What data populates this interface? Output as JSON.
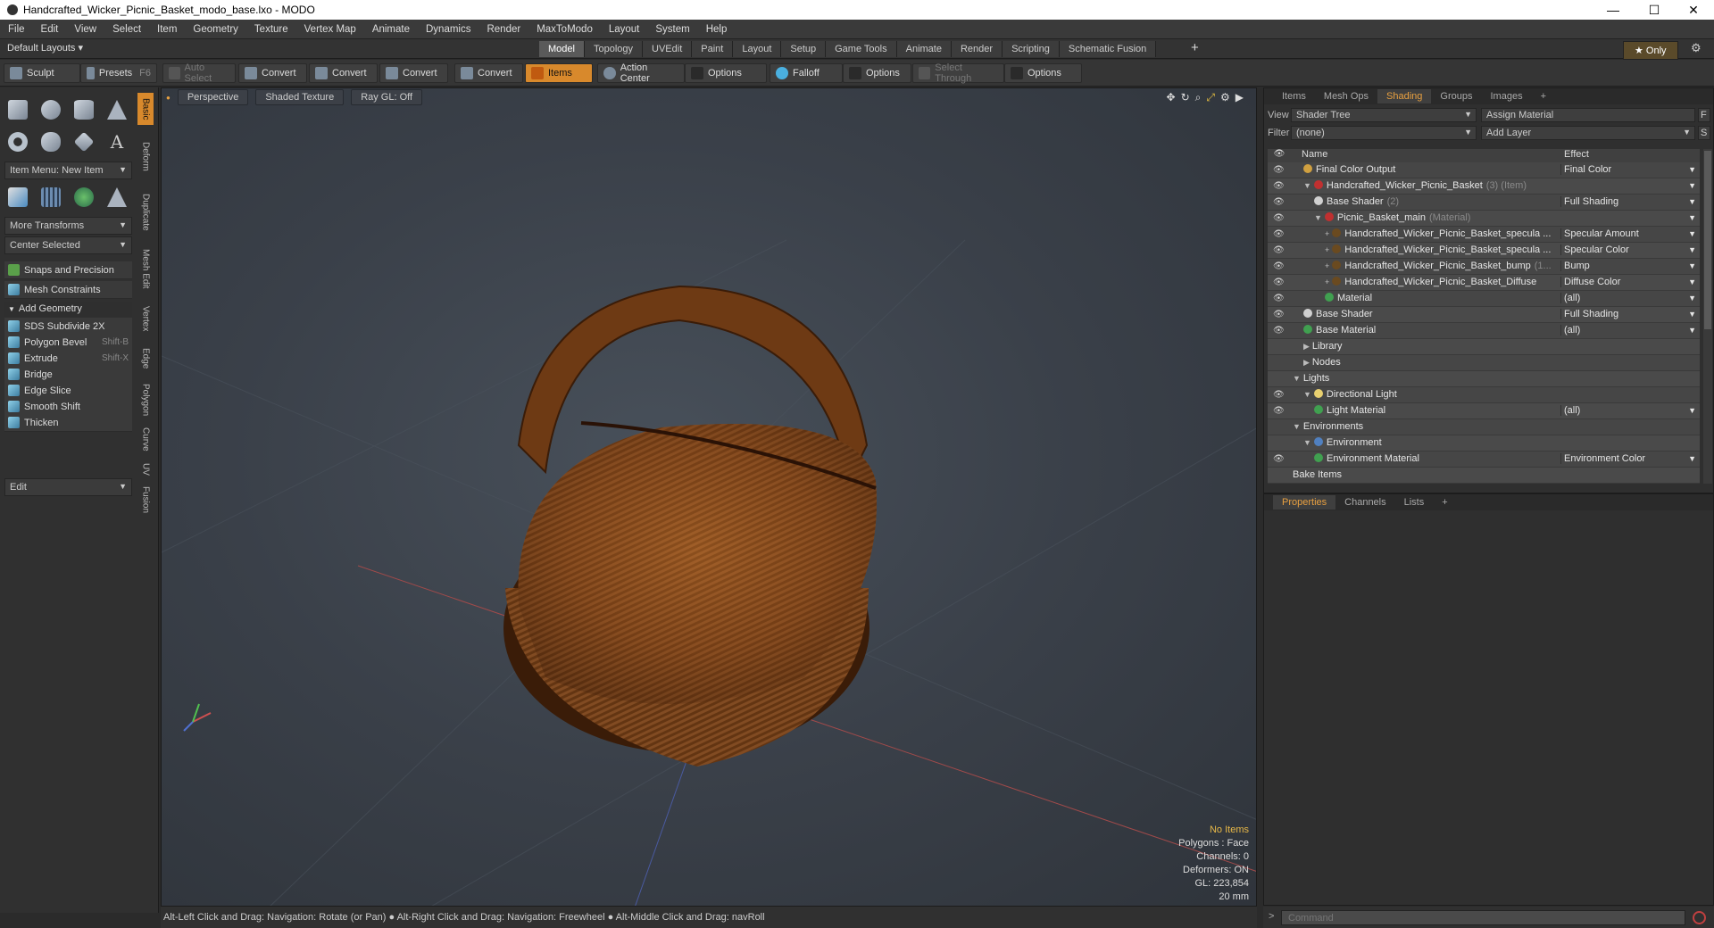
{
  "window": {
    "title": "Handcrafted_Wicker_Picnic_Basket_modo_base.lxo - MODO"
  },
  "menu": [
    "File",
    "Edit",
    "View",
    "Select",
    "Item",
    "Geometry",
    "Texture",
    "Vertex Map",
    "Animate",
    "Dynamics",
    "Render",
    "MaxToModo",
    "Layout",
    "System",
    "Help"
  ],
  "layout": {
    "default": "Default Layouts ▾",
    "tabs": [
      "Model",
      "Topology",
      "UVEdit",
      "Paint",
      "Layout",
      "Setup",
      "Game Tools",
      "Animate",
      "Render",
      "Scripting",
      "Schematic Fusion"
    ],
    "active": "Model",
    "plus": "+",
    "only": "★  Only"
  },
  "toolbar": {
    "sculpt": "Sculpt",
    "presets": "Presets",
    "presets_key": "F6",
    "auto_select": "Auto Select",
    "convert": "Convert",
    "items": "Items",
    "action_center": "Action Center",
    "options": "Options",
    "falloff": "Falloff",
    "select_through": "Select Through"
  },
  "left": {
    "item_menu": "Item Menu: New Item",
    "more_transforms": "More Transforms",
    "center_selected": "Center Selected",
    "snaps": "Snaps and Precision",
    "mesh_constraints": "Mesh Constraints",
    "add_geometry": "Add Geometry",
    "tools": [
      {
        "label": "SDS Subdivide 2X",
        "key": ""
      },
      {
        "label": "Polygon Bevel",
        "key": "Shift-B"
      },
      {
        "label": "Extrude",
        "key": "Shift-X"
      },
      {
        "label": "Bridge",
        "key": ""
      },
      {
        "label": "Edge Slice",
        "key": ""
      },
      {
        "label": "Smooth Shift",
        "key": ""
      },
      {
        "label": "Thicken",
        "key": ""
      }
    ],
    "edit": "Edit",
    "vtabs": [
      "Basic",
      "Deform",
      "Duplicate",
      "Mesh Edit",
      "Vertex",
      "Edge",
      "Polygon",
      "Curve",
      "UV",
      "Fusion"
    ]
  },
  "viewport": {
    "perspective": "Perspective",
    "shading": "Shaded Texture",
    "raygl": "Ray GL: Off",
    "stats": {
      "items": "No Items",
      "polygons": "Polygons : Face",
      "channels": "Channels: 0",
      "deformers": "Deformers: ON",
      "gl": "GL: 223,854",
      "scale": "20 mm"
    }
  },
  "status": "Alt-Left Click and Drag: Navigation: Rotate (or Pan) ● Alt-Right Click and Drag: Navigation: Freewheel ● Alt-Middle Click and Drag: navRoll",
  "command": {
    "placeholder": "Command"
  },
  "shading": {
    "tabs": [
      "Items",
      "Mesh Ops",
      "Shading",
      "Groups",
      "Images",
      "+"
    ],
    "active": "Shading",
    "view_label": "View",
    "view_value": "Shader Tree",
    "assign": "Assign Material",
    "f": "F",
    "filter_label": "Filter",
    "filter_value": "(none)",
    "add_layer": "Add Layer",
    "s": "S",
    "col_name": "Name",
    "col_effect": "Effect",
    "rows": [
      {
        "indent": 1,
        "name": "Final Color Output",
        "suffix": "",
        "effect": "Final Color",
        "ball": "#d0a040",
        "eye": true,
        "exp": "",
        "dd": true
      },
      {
        "indent": 1,
        "name": "Handcrafted_Wicker_Picnic_Basket",
        "suffix": "(3) (Item)",
        "effect": "",
        "ball": "#c03030",
        "eye": true,
        "exp": "▼",
        "dd": true
      },
      {
        "indent": 2,
        "name": "Base Shader",
        "suffix": "(2)",
        "effect": "Full Shading",
        "ball": "#d0d0d0",
        "eye": true,
        "exp": "",
        "dd": true
      },
      {
        "indent": 2,
        "name": "Picnic_Basket_main",
        "suffix": "(Material)",
        "effect": "",
        "ball": "#c03030",
        "eye": true,
        "exp": "▼",
        "dd": true
      },
      {
        "indent": 3,
        "name": "Handcrafted_Wicker_Picnic_Basket_specula ...",
        "suffix": "",
        "effect": "Specular Amount",
        "ball": "#6a4a20",
        "eye": true,
        "exp": "+",
        "dd": true
      },
      {
        "indent": 3,
        "name": "Handcrafted_Wicker_Picnic_Basket_specula ...",
        "suffix": "",
        "effect": "Specular Color",
        "ball": "#6a4a20",
        "eye": true,
        "exp": "+",
        "dd": true
      },
      {
        "indent": 3,
        "name": "Handcrafted_Wicker_Picnic_Basket_bump",
        "suffix": "(1...",
        "effect": "Bump",
        "ball": "#6a4a20",
        "eye": true,
        "exp": "+",
        "dd": true
      },
      {
        "indent": 3,
        "name": "Handcrafted_Wicker_Picnic_Basket_Diffuse",
        "suffix": "",
        "effect": "Diffuse Color",
        "ball": "#6a4a20",
        "eye": true,
        "exp": "+",
        "dd": true
      },
      {
        "indent": 3,
        "name": "Material",
        "suffix": "",
        "effect": "(all)",
        "ball": "#40a050",
        "eye": true,
        "exp": "",
        "dd": true
      },
      {
        "indent": 1,
        "name": "Base Shader",
        "suffix": "",
        "effect": "Full Shading",
        "ball": "#d0d0d0",
        "eye": true,
        "exp": "",
        "dd": true
      },
      {
        "indent": 1,
        "name": "Base Material",
        "suffix": "",
        "effect": "(all)",
        "ball": "#40a050",
        "eye": true,
        "exp": "",
        "dd": true
      },
      {
        "indent": 1,
        "name": "Library",
        "suffix": "",
        "effect": "",
        "ball": "",
        "eye": false,
        "exp": "▶",
        "dd": false
      },
      {
        "indent": 1,
        "name": "Nodes",
        "suffix": "",
        "effect": "",
        "ball": "",
        "eye": false,
        "exp": "▶",
        "dd": false
      },
      {
        "indent": 0,
        "name": "Lights",
        "suffix": "",
        "effect": "",
        "ball": "",
        "eye": false,
        "exp": "▼",
        "dd": false
      },
      {
        "indent": 1,
        "name": "Directional Light",
        "suffix": "",
        "effect": "",
        "ball": "#e8d070",
        "eye": true,
        "exp": "▼",
        "dd": false
      },
      {
        "indent": 2,
        "name": "Light Material",
        "suffix": "",
        "effect": "(all)",
        "ball": "#40a050",
        "eye": true,
        "exp": "",
        "dd": true
      },
      {
        "indent": 0,
        "name": "Environments",
        "suffix": "",
        "effect": "",
        "ball": "",
        "eye": false,
        "exp": "▼",
        "dd": false
      },
      {
        "indent": 1,
        "name": "Environment",
        "suffix": "",
        "effect": "",
        "ball": "#5080c0",
        "eye": false,
        "exp": "▼",
        "dd": false
      },
      {
        "indent": 2,
        "name": "Environment Material",
        "suffix": "",
        "effect": "Environment Color",
        "ball": "#40a050",
        "eye": true,
        "exp": "",
        "dd": true
      },
      {
        "indent": 0,
        "name": "Bake Items",
        "suffix": "",
        "effect": "",
        "ball": "",
        "eye": false,
        "exp": "",
        "dd": false
      }
    ]
  },
  "properties": {
    "tabs": [
      "Properties",
      "Channels",
      "Lists",
      "+"
    ],
    "active": "Properties"
  }
}
